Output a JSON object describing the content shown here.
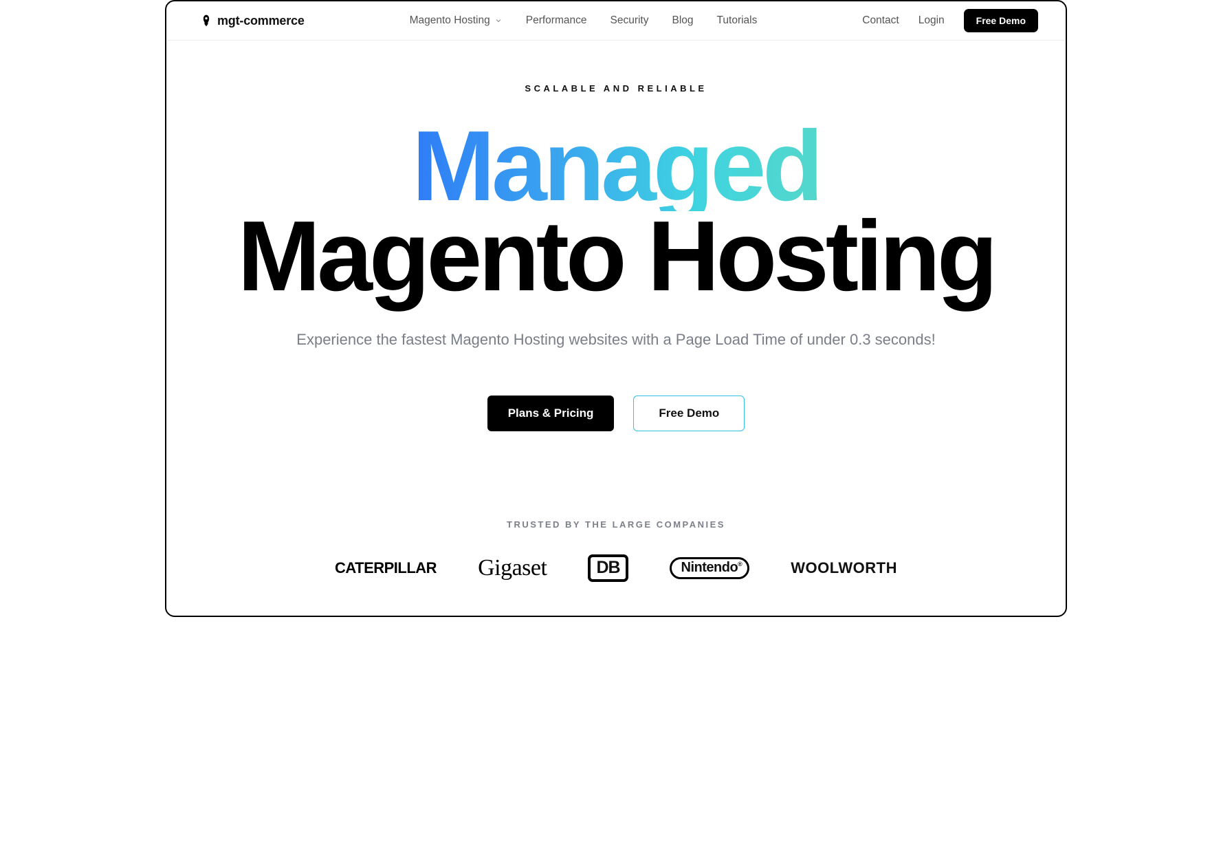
{
  "brand": "mgt-commerce",
  "nav": {
    "primary": [
      {
        "label": "Magento Hosting",
        "hasDropdown": true
      },
      {
        "label": "Performance",
        "hasDropdown": false
      },
      {
        "label": "Security",
        "hasDropdown": false
      },
      {
        "label": "Blog",
        "hasDropdown": false
      },
      {
        "label": "Tutorials",
        "hasDropdown": false
      }
    ],
    "right": [
      {
        "label": "Contact"
      },
      {
        "label": "Login"
      }
    ],
    "cta": "Free Demo"
  },
  "hero": {
    "kicker": "SCALABLE AND RELIABLE",
    "headline_line1": "Managed",
    "headline_line2": "Magento Hosting",
    "subhead": "Experience the fastest Magento Hosting websites with a Page Load Time of under 0.3 seconds!",
    "cta_primary": "Plans & Pricing",
    "cta_secondary": "Free Demo"
  },
  "trusted": {
    "title": "TRUSTED BY THE LARGE COMPANIES",
    "logos": [
      "CATERPILLAR",
      "Gigaset",
      "DB",
      "Nintendo",
      "WOOLWORTH"
    ]
  },
  "colors": {
    "gradient_start": "#2f7cf6",
    "gradient_end": "#55d7ca",
    "outline_button_border": "#33c1e8"
  }
}
